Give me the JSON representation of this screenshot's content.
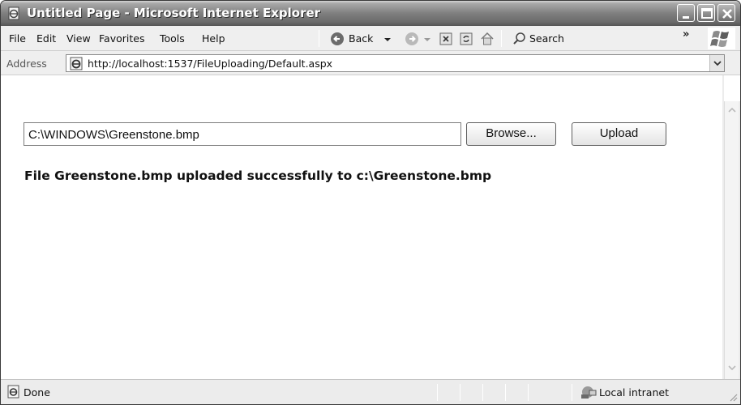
{
  "window": {
    "title": "Untitled Page - Microsoft Internet Explorer"
  },
  "menu": {
    "items": [
      "File",
      "Edit",
      "View",
      "Favorites",
      "Tools",
      "Help"
    ]
  },
  "toolbar": {
    "back_label": "Back",
    "search_label": "Search",
    "overflow_label": "»",
    "icons": [
      "back-arrow-icon",
      "forward-arrow-icon",
      "stop-icon",
      "refresh-icon",
      "home-icon",
      "search-icon",
      "windows-logo-icon"
    ]
  },
  "address": {
    "label": "Address",
    "url": "http://localhost:1537/FileUploading/Default.aspx"
  },
  "page": {
    "file_path": "C:\\WINDOWS\\Greenstone.bmp",
    "browse_label": "Browse...",
    "upload_label": "Upload",
    "message": "File Greenstone.bmp uploaded successfully to c:\\Greenstone.bmp"
  },
  "status": {
    "text": "Done",
    "zone": "Local intranet"
  }
}
